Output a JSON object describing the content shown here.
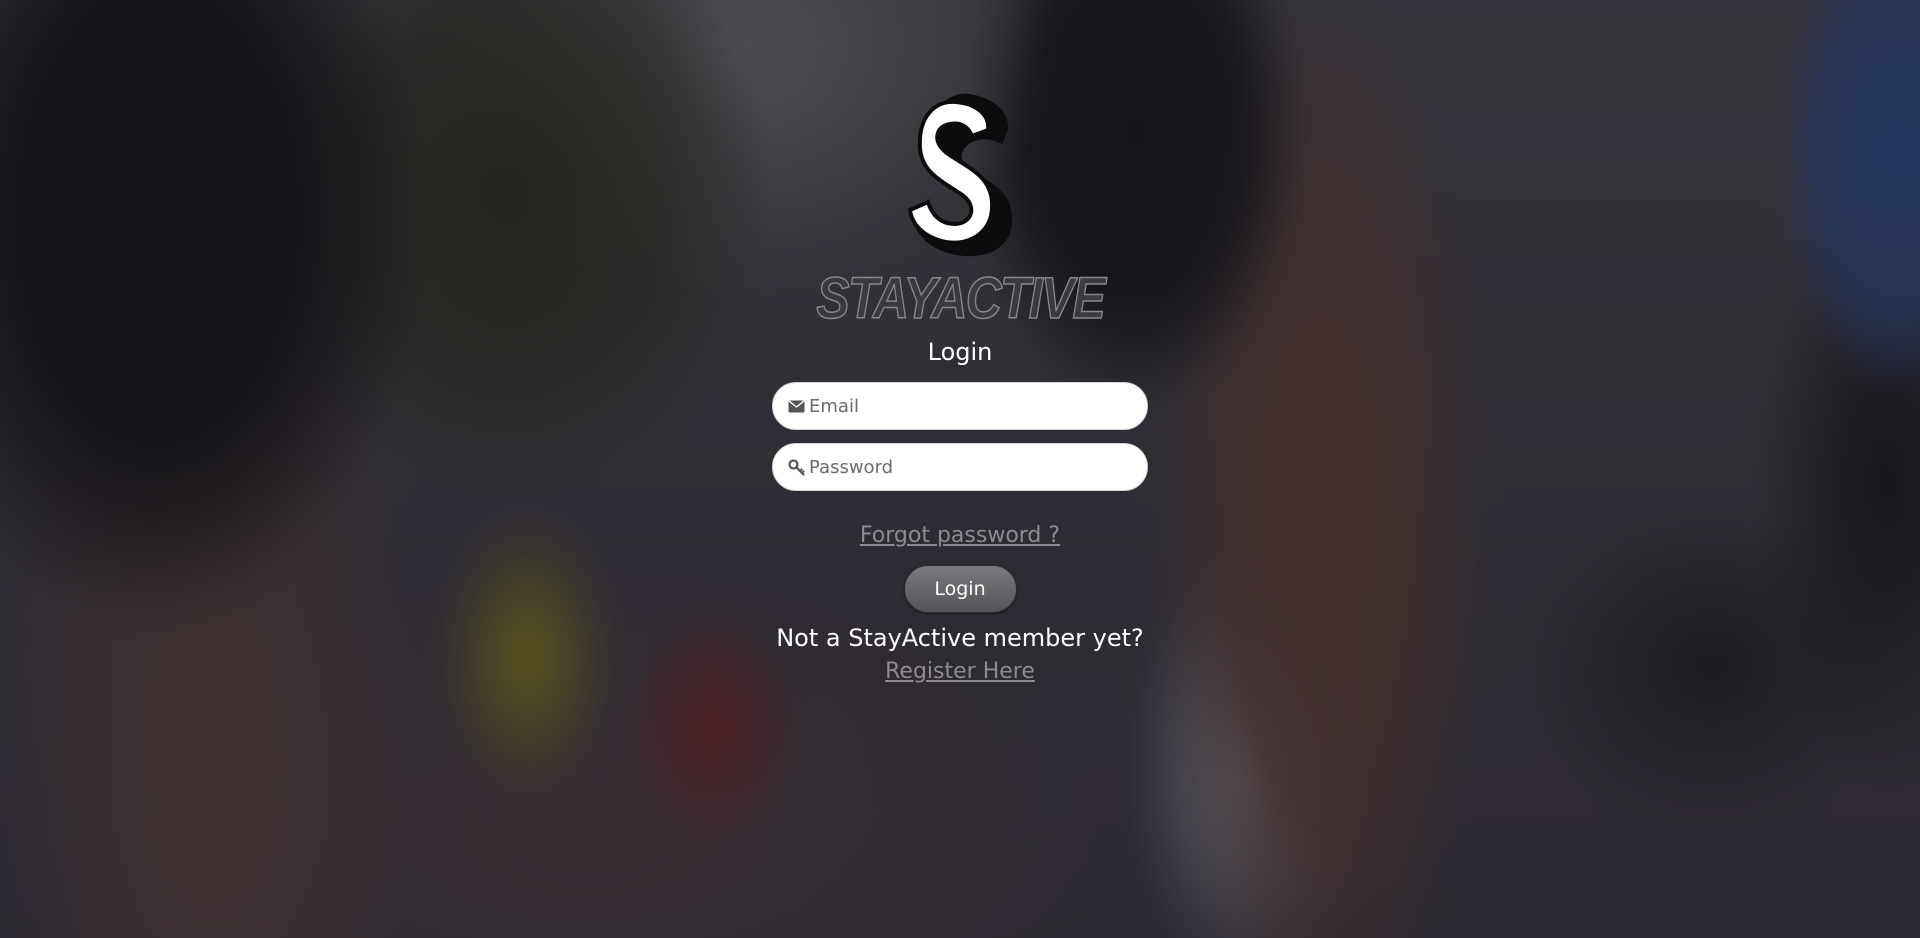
{
  "brand": {
    "logo_icon": "s-logo-icon",
    "name": "STAYACTIVE"
  },
  "login": {
    "title": "Login",
    "email": {
      "icon": "envelope-icon",
      "placeholder": "Email",
      "value": ""
    },
    "password": {
      "icon": "key-icon",
      "placeholder": "Password",
      "value": ""
    },
    "forgot_label": "Forgot password ?",
    "submit_label": "Login",
    "register_prompt": "Not a StayActive member yet?",
    "register_label": "Register Here"
  },
  "colors": {
    "text_primary": "#ffffff",
    "link": "#8e8c92",
    "button": "#6a686c",
    "field_bg": "#ffffff"
  }
}
